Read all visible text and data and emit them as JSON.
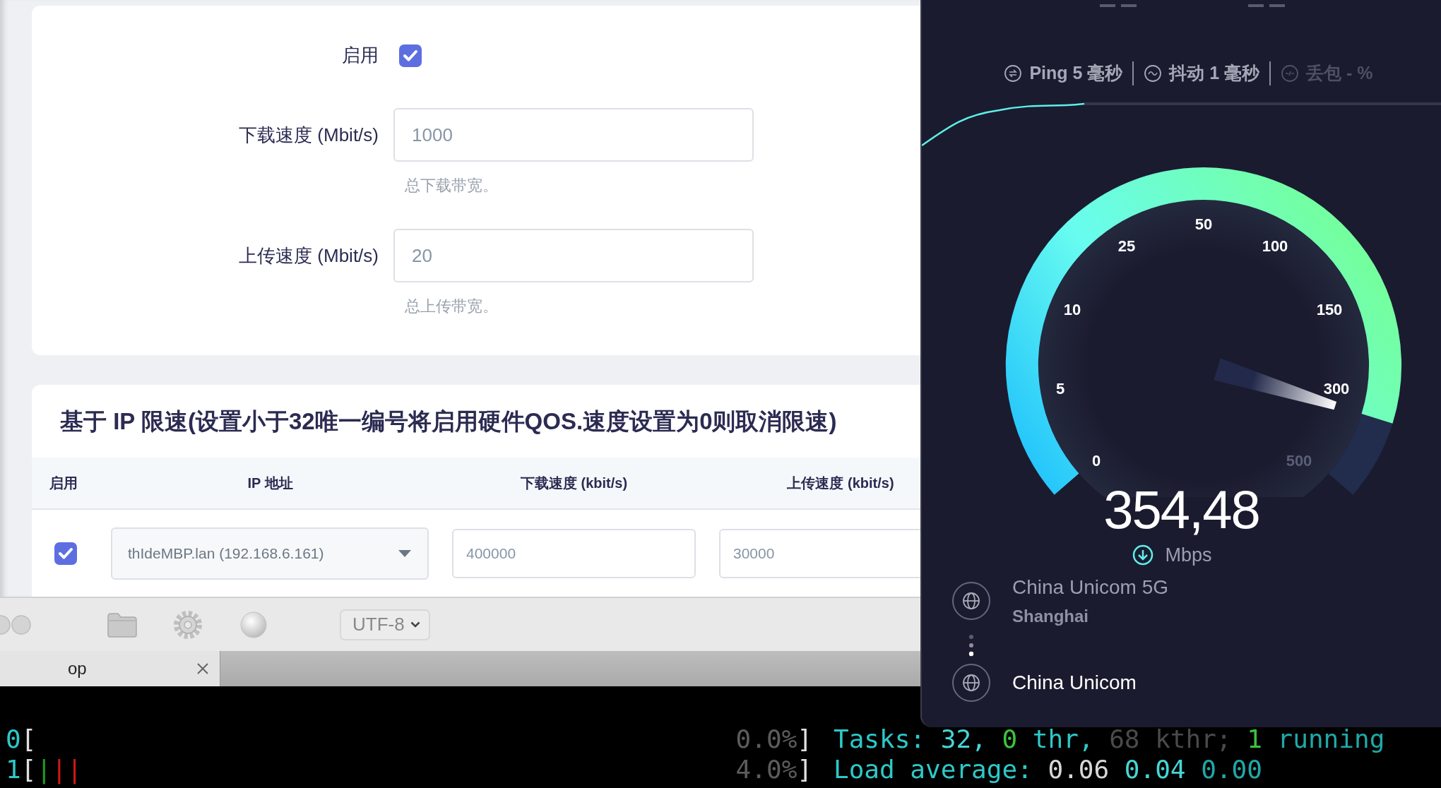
{
  "settings": {
    "enable": {
      "label": "启用",
      "checked": true
    },
    "fields": [
      {
        "label": "下载速度 (Mbit/s)",
        "value": "1000",
        "help": "总下载带宽。"
      },
      {
        "label": "上传速度 (Mbit/s)",
        "value": "20",
        "help": "总上传带宽。"
      }
    ]
  },
  "ip_limit": {
    "title": "基于 IP 限速(设置小于32唯一编号将启用硬件QOS.速度设置为0则取消限速)",
    "columns": [
      "启用",
      "IP 地址",
      "下载速度 (kbit/s)",
      "上传速度 (kbit/s)"
    ],
    "rows": [
      {
        "checked": true,
        "ip": "thIdeMBP.lan (192.168.6.161)",
        "download": "400000",
        "upload": "30000"
      }
    ]
  },
  "toolbar": {
    "encoding": "UTF-8"
  },
  "terminal_tabs": [
    {
      "label": "op",
      "selected": true
    }
  ],
  "terminal": {
    "lines": [
      {
        "meter": [
          {
            "text": "0",
            "color": "#2ec8c8"
          },
          {
            "text": "[",
            "color": "#e0e0e0"
          }
        ],
        "percent": [
          {
            "text": "0.0%",
            "color": "#5c5c5c"
          },
          {
            "text": "]",
            "color": "#e0e0e0"
          }
        ],
        "info": [
          {
            "text": "Tasks: ",
            "color": "#2ec8c8"
          },
          {
            "text": "32, ",
            "color": "#45d6d6"
          },
          {
            "text": "0",
            "color": "#3cc43c"
          },
          {
            "text": " thr, ",
            "color": "#2ec8c8"
          },
          {
            "text": "68 kthr; ",
            "color": "#4a4a4a"
          },
          {
            "text": "1",
            "color": "#3cc43c"
          },
          {
            "text": " running",
            "color": "#20a8a8"
          }
        ]
      },
      {
        "meter": [
          {
            "text": "1",
            "color": "#2ec8c8"
          },
          {
            "text": "[",
            "color": "#e0e0e0"
          },
          {
            "text": "|",
            "color": "#1f9a1f"
          },
          {
            "text": "||",
            "color": "#d01818"
          }
        ],
        "percent": [
          {
            "text": "4.0%",
            "color": "#5c5c5c"
          },
          {
            "text": "]",
            "color": "#e0e0e0"
          }
        ],
        "info": [
          {
            "text": "Load average: ",
            "color": "#2ec8c8"
          },
          {
            "text": "0.06 ",
            "color": "#d8d8d8"
          },
          {
            "text": "0.04 ",
            "color": "#45d6d6"
          },
          {
            "text": "0.00",
            "color": "#20a8a8"
          }
        ]
      }
    ]
  },
  "speedtest": {
    "stats": [
      {
        "kind": "ping",
        "label": "Ping 5 毫秒",
        "disabled": false
      },
      {
        "kind": "jitter",
        "label": "抖动 1 毫秒",
        "disabled": false
      },
      {
        "kind": "loss",
        "label": "丢包 - %",
        "disabled": true
      }
    ],
    "gauge": {
      "ticks": [
        {
          "label": "0",
          "reached": true
        },
        {
          "label": "5",
          "reached": true
        },
        {
          "label": "10",
          "reached": true
        },
        {
          "label": "25",
          "reached": true
        },
        {
          "label": "50",
          "reached": true
        },
        {
          "label": "100",
          "reached": true
        },
        {
          "label": "150",
          "reached": true
        },
        {
          "label": "300",
          "reached": true
        },
        {
          "label": "500",
          "reached": false
        }
      ]
    },
    "speed": "354,48",
    "unit": "Mbps",
    "server": {
      "provider": "China Unicom 5G",
      "location": "Shanghai",
      "isp": "China Unicom"
    }
  }
}
